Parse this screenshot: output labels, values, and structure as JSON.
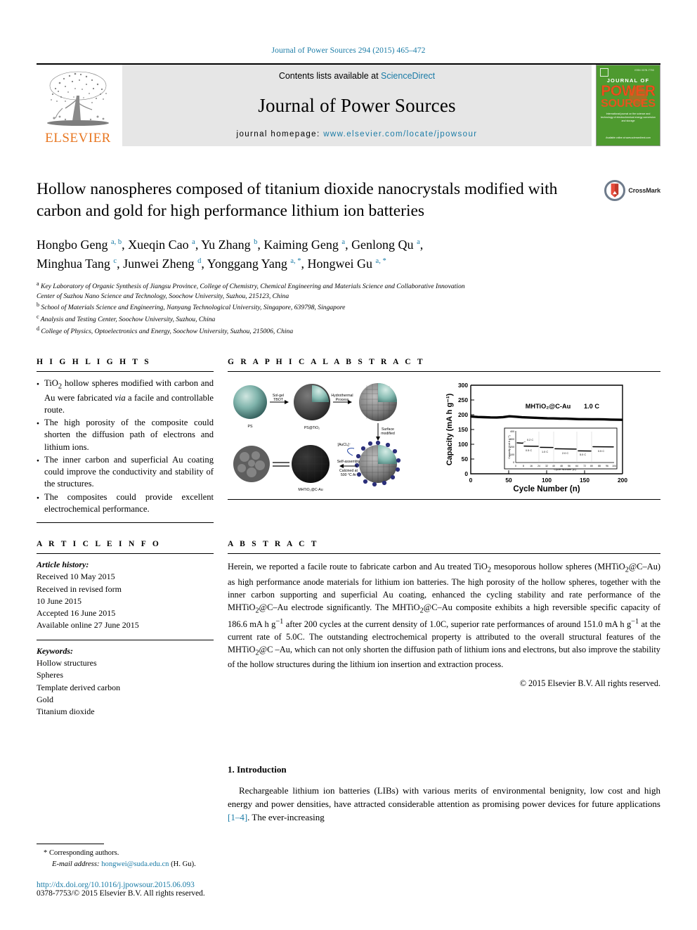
{
  "running_head": "Journal of Power Sources 294 (2015) 465–472",
  "masthead": {
    "contents_prefix": "Contents lists available at ",
    "sciencedirect": "ScienceDirect",
    "journal_title": "Journal of Power Sources",
    "homepage_prefix": "journal homepage: ",
    "homepage_url": "www.elsevier.com/locate/jpowsour",
    "publisher": "ELSEVIER",
    "cover": {
      "line_jof": "JOURNAL OF",
      "line_power": "POWER",
      "line_sources": "SOURCES",
      "sub": "International journal on the science and technology of electrochemical energy conversion and storage",
      "bottom": "Available online at www.sciencedirect.com"
    }
  },
  "article": {
    "title": "Hollow nanospheres composed of titanium dioxide nanocrystals modified with carbon and gold for high performance lithium ion batteries",
    "crossmark_label": "CrossMark",
    "authors_line1": "Hongbo Geng a, b, Xueqin Cao a, Yu Zhang b, Kaiming Geng a, Genlong Qu a,",
    "authors_line2": "Minghua Tang c, Junwei Zheng d, Yonggang Yang a, *, Hongwei Gu a, *",
    "affiliations": [
      "a Key Laboratory of Organic Synthesis of Jiangsu Province, College of Chemistry, Chemical Engineering and Materials Science and Collaborative Innovation Center of Suzhou Nano Science and Technology, Soochow University, Suzhou, 215123, China",
      "b School of Materials Science and Engineering, Nanyang Technological University, Singapore, 639798, Singapore",
      "c Analysis and Testing Center, Soochow University, Suzhou, China",
      "d College of Physics, Optoelectronics and Energy, Soochow University, Suzhou, 215006, China"
    ]
  },
  "highlights": {
    "heading": "H I G H L I G H T S",
    "items": [
      "TiO2 hollow spheres modified with carbon and Au were fabricated via a facile and controllable route.",
      "The high porosity of the composite could shorten the diffusion path of electrons and lithium ions.",
      "The inner carbon and superficial Au coating could improve the conductivity and stability of the structures.",
      "The composites could provide excellent electrochemical performance."
    ]
  },
  "graphical_abstract": {
    "heading": "G R A P H I C A L   A B S T R A C T",
    "scheme_labels": {
      "ps": "PS",
      "ps_tio2": "PS@TiO2",
      "final": "MHTiO2@C-Au",
      "arrow1_l1": "Sol-gel",
      "arrow1_l2": "TBOT",
      "arrow2_l1": "Hydrothermal",
      "arrow2_l2": "Process",
      "arrow3_l1": "Surface",
      "arrow3_l2": "modified",
      "arrow4_l1": "Self-assembly",
      "arrow4_l2": "Calcined at",
      "arrow4_l3": "500 °C Ar",
      "aucl4": "[AuCl4]−"
    }
  },
  "chart_data": {
    "type": "line",
    "title": "",
    "xlabel": "Cycle Number (n)",
    "ylabel": "Capacity (mA h g⁻¹)",
    "annotation": "MHTiO2@C-Au",
    "rate_label": "1.0 C",
    "xlim": [
      0,
      200
    ],
    "ylim": [
      0,
      300
    ],
    "xticks": [
      0,
      50,
      100,
      150,
      200
    ],
    "yticks": [
      0,
      50,
      100,
      150,
      200,
      250,
      300
    ],
    "series": [
      {
        "name": "MHTiO2@C-Au at 1.0 C",
        "x": [
          1,
          10,
          20,
          30,
          40,
          50,
          60,
          70,
          80,
          90,
          100,
          110,
          120,
          130,
          140,
          150,
          160,
          170,
          180,
          190,
          200
        ],
        "y": [
          196,
          194,
          193,
          192,
          192,
          194,
          197,
          195,
          193,
          192,
          191,
          190,
          189,
          189,
          188,
          188,
          187,
          186,
          186,
          186,
          186.6
        ]
      }
    ],
    "inset": {
      "type": "line",
      "xlabel": "Cycle Number (n)",
      "ylabel": "Capacity (mA h g⁻¹)",
      "xlim": [
        0,
        104
      ],
      "ylim": [
        0,
        400
      ],
      "xticks": [
        0,
        8,
        16,
        24,
        32,
        40,
        48,
        56,
        64,
        72,
        80,
        88,
        96,
        104
      ],
      "yticks": [
        0,
        100,
        200,
        300,
        400
      ],
      "rate_steps": [
        {
          "label": "0.2 C",
          "cycles": [
            1,
            8
          ],
          "capacity": 255
        },
        {
          "label": "0.5 C",
          "cycles": [
            9,
            24
          ],
          "capacity": 213
        },
        {
          "label": "1.0 C",
          "cycles": [
            25,
            40
          ],
          "capacity": 196
        },
        {
          "label": "2.0 C",
          "cycles": [
            41,
            64
          ],
          "capacity": 178
        },
        {
          "label": "5.0 C",
          "cycles": [
            65,
            80
          ],
          "capacity": 151
        },
        {
          "label": "0.5 C",
          "cycles": [
            81,
            104
          ],
          "capacity": 205
        }
      ]
    }
  },
  "article_info": {
    "heading": "A R T I C L E   I N F O",
    "history_label": "Article history:",
    "history": [
      "Received 10 May 2015",
      "Received in revised form",
      "10 June 2015",
      "Accepted 16 June 2015",
      "Available online 27 June 2015"
    ],
    "keywords_label": "Keywords:",
    "keywords": [
      "Hollow structures",
      "Spheres",
      "Template derived carbon",
      "Gold",
      "Titanium dioxide"
    ]
  },
  "abstract": {
    "heading": "A B S T R A C T",
    "text": "Herein, we reported a facile route to fabricate carbon and Au treated TiO2 mesoporous hollow spheres (MHTiO2@C–Au) as high performance anode materials for lithium ion batteries. The high porosity of the hollow spheres, together with the inner carbon supporting and superficial Au coating, enhanced the cycling stability and rate performance of the MHTiO2@C–Au electrode significantly. The MHTiO2@C–Au composite exhibits a high reversible specific capacity of 186.6 mA h g−1 after 200 cycles at the current density of 1.0C, superior rate performances of around 151.0 mA h g−1 at the current rate of 5.0C. The outstanding electrochemical property is attributed to the overall structural features of the MHTiO2@C–Au, which can not only shorten the diffusion path of lithium ions and electrons, but also improve the stability of the hollow structures during the lithium ion insertion and extraction process.",
    "copyright": "© 2015 Elsevier B.V. All rights reserved."
  },
  "introduction": {
    "heading": "1.  Introduction",
    "paragraph_pre": "Rechargeable lithium ion batteries (LIBs) with various merits of environmental benignity, low cost and high energy and power densities, have attracted considerable attention as promising power devices for future applications ",
    "citation": "[1–4]",
    "paragraph_post": ". The ever-increasing"
  },
  "footer": {
    "corresponding": "Corresponding authors.",
    "email_label": "E-mail address:",
    "email": "hongwei@suda.edu.cn",
    "email_suffix": "(H. Gu).",
    "doi": "http://dx.doi.org/10.1016/j.jpowsour.2015.06.093",
    "issn": "0378-7753/© 2015 Elsevier B.V. All rights reserved."
  }
}
